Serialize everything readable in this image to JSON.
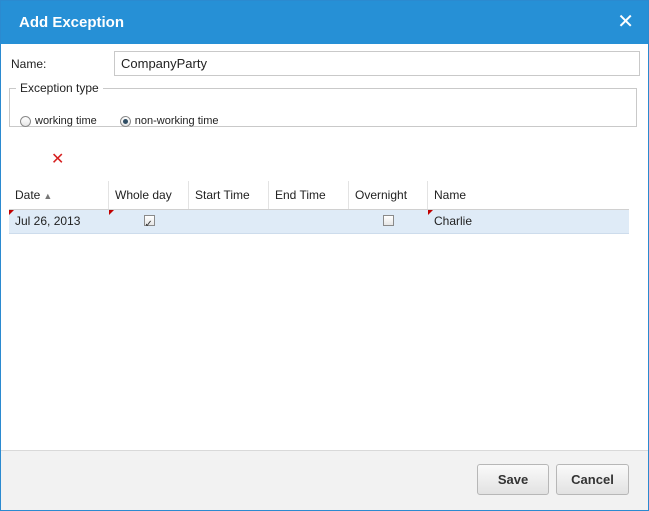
{
  "dialog": {
    "title": "Add Exception",
    "close_glyph": "✕",
    "close_icon": "close-icon"
  },
  "name": {
    "label": "Name:",
    "value": "CompanyParty"
  },
  "exception_type": {
    "legend": "Exception type",
    "options": [
      {
        "label": "working time",
        "selected": false
      },
      {
        "label": "non-working time",
        "selected": true
      }
    ]
  },
  "toolbar": {
    "delete_glyph": "✕",
    "delete_icon": "delete-icon",
    "delete_color": "#d61f1f"
  },
  "grid": {
    "columns": [
      "Date",
      "Whole day",
      "Start Time",
      "End Time",
      "Overnight",
      "Name"
    ],
    "sort_indicator": "▲",
    "sort_icon": "sort-ascending-icon",
    "rows": [
      {
        "date": "Jul 26, 2013",
        "whole_day": true,
        "start_time": "",
        "end_time": "",
        "overnight": false,
        "name": "Charlie"
      }
    ]
  },
  "footer": {
    "save_label": "Save",
    "cancel_label": "Cancel"
  },
  "colors": {
    "titlebar": "#2690d6",
    "selected_row": "#dfebf7"
  }
}
